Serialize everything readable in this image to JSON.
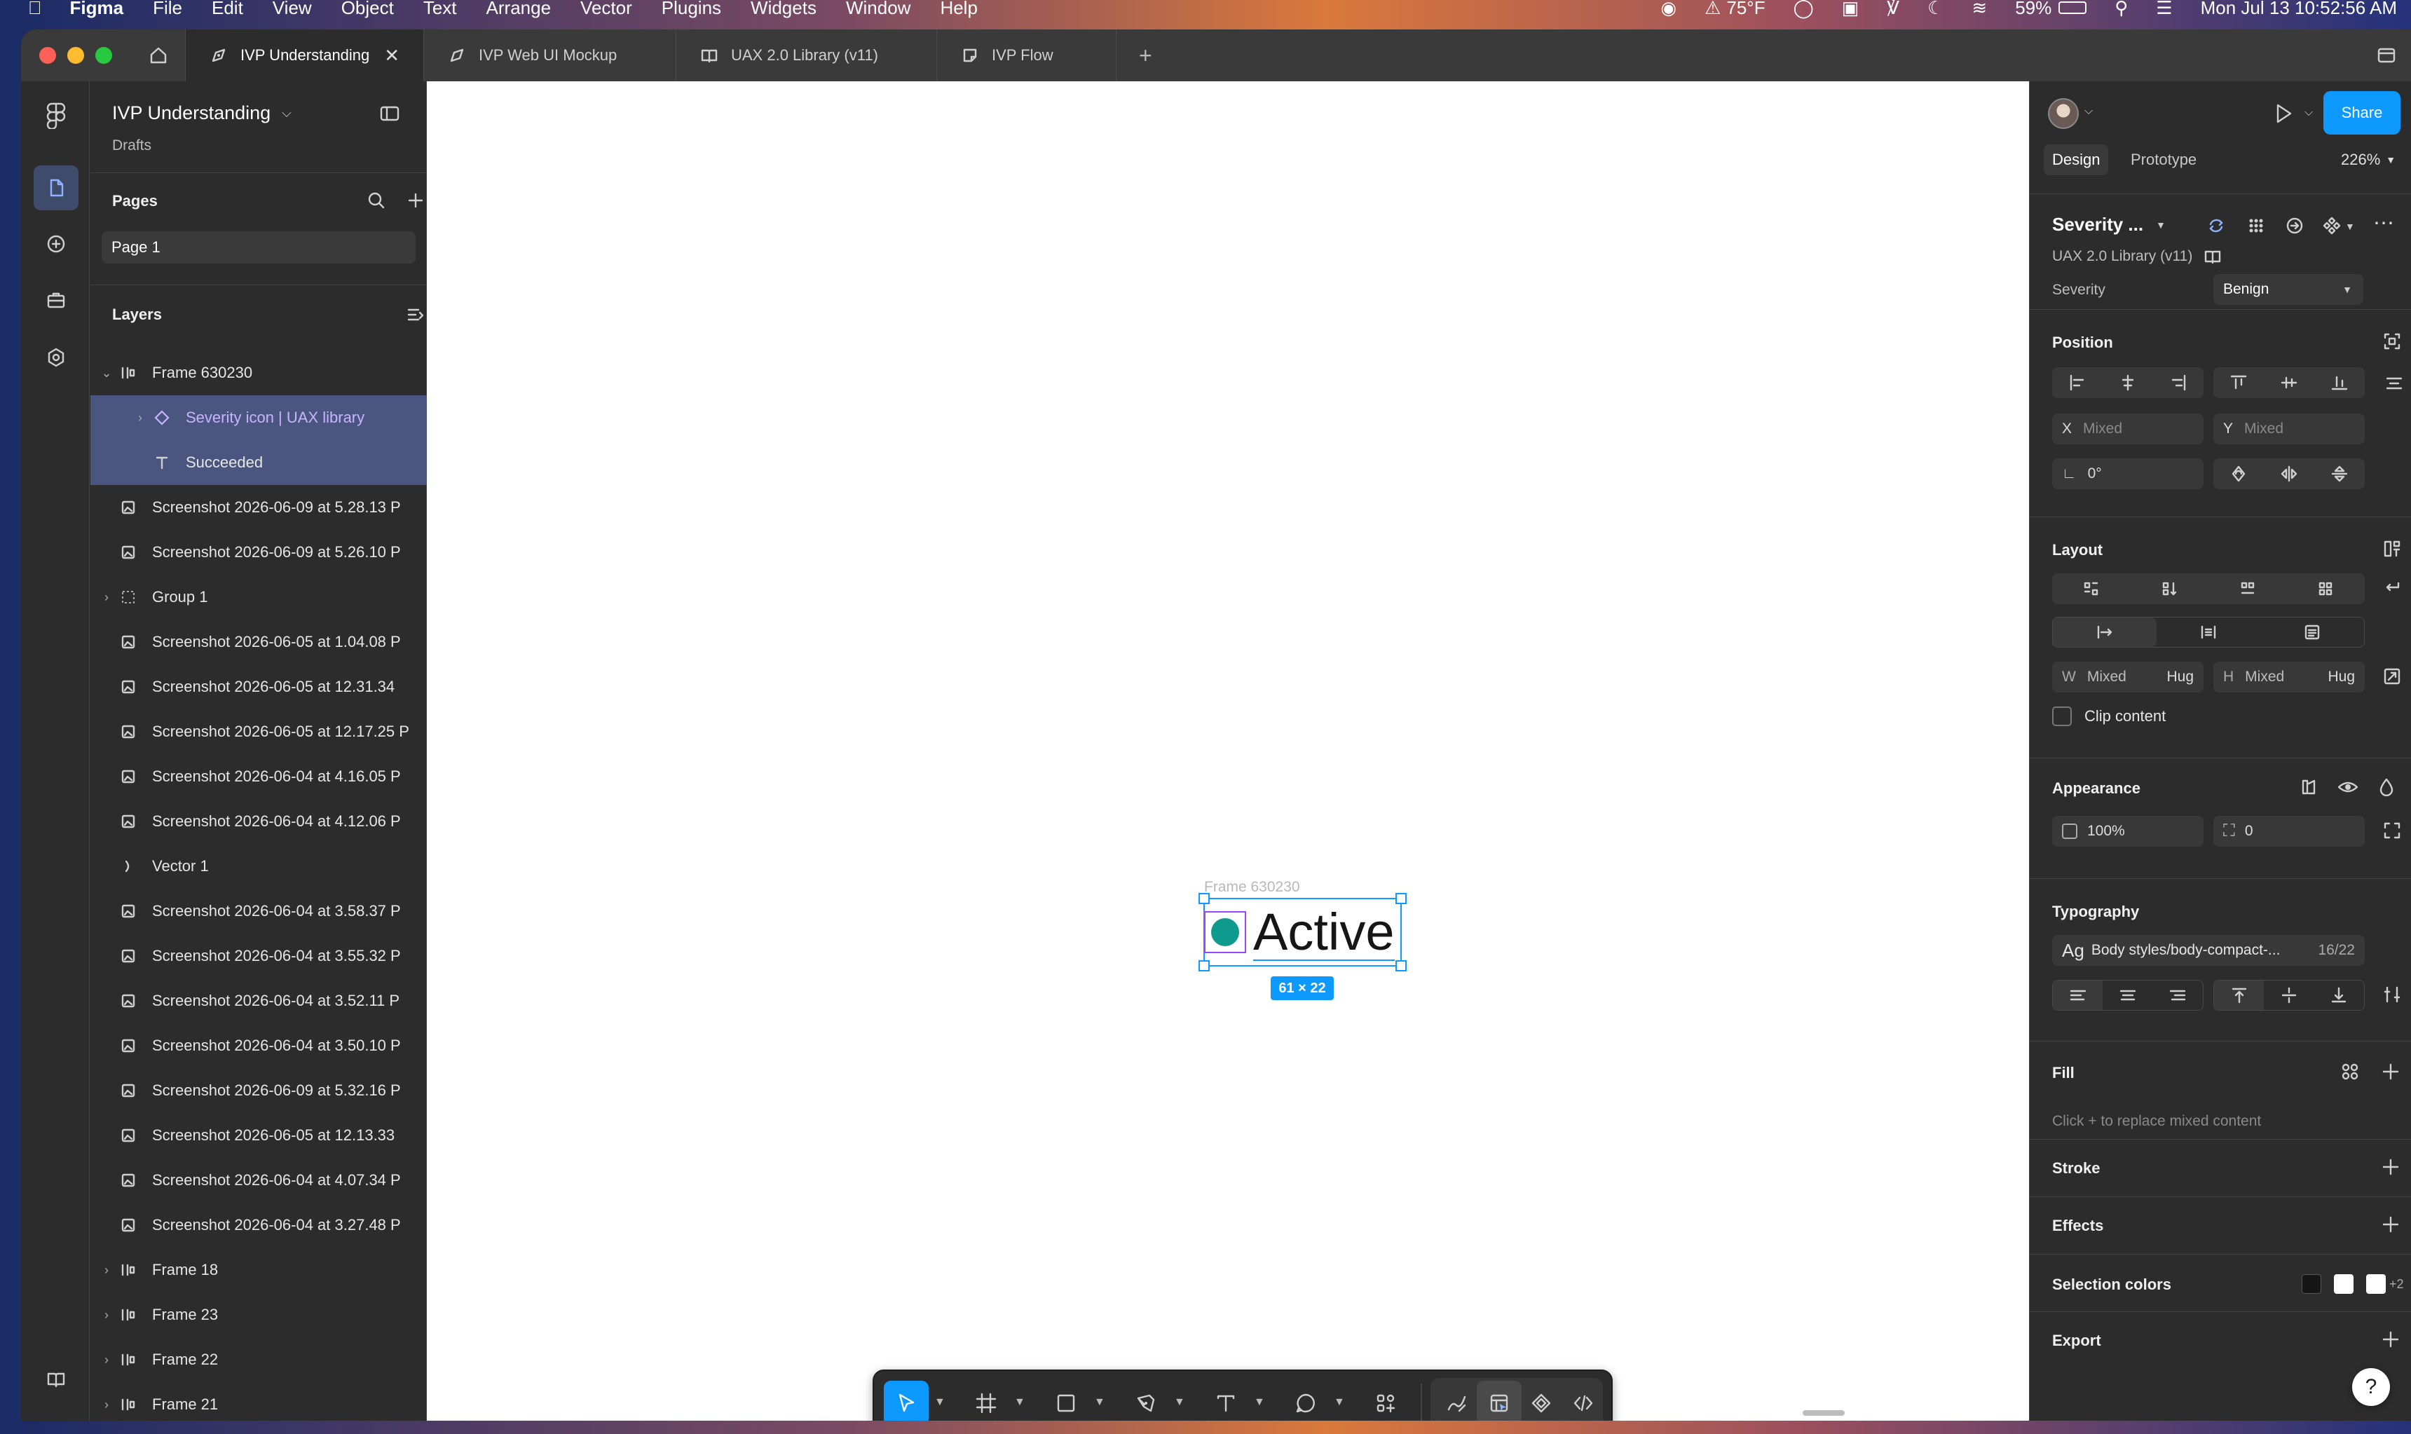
{
  "menubar": {
    "app": "Figma",
    "items": [
      "File",
      "Edit",
      "View",
      "Object",
      "Text",
      "Arrange",
      "Vector",
      "Plugins",
      "Widgets",
      "Window",
      "Help"
    ],
    "weather": "75°F",
    "battery": "59%",
    "datetime": "Mon Jul 13  10:52:56 AM"
  },
  "tabs": [
    {
      "label": "IVP Understanding",
      "icon": "design-file-icon"
    },
    {
      "label": "IVP Web UI Mockup",
      "icon": "design-file-icon"
    },
    {
      "label": "UAX 2.0 Library (v11)",
      "icon": "library-icon"
    },
    {
      "label": "IVP Flow",
      "icon": "figjam-icon"
    }
  ],
  "file": {
    "name": "IVP Understanding",
    "location": "Drafts"
  },
  "pages": {
    "title": "Pages",
    "items": [
      "Page 1"
    ]
  },
  "layers": {
    "title": "Layers",
    "items": [
      {
        "label": "Frame 630230",
        "type": "frame",
        "indent": 0,
        "expanded": true
      },
      {
        "label": "Severity icon | UAX library",
        "type": "instance",
        "indent": 1,
        "selected": true
      },
      {
        "label": "Succeeded",
        "type": "text",
        "indent": 1,
        "selected": true
      },
      {
        "label": "Screenshot 2026-06-09 at 5.28.13 P",
        "type": "image",
        "indent": 0
      },
      {
        "label": "Screenshot 2026-06-09 at 5.26.10 P",
        "type": "image",
        "indent": 0
      },
      {
        "label": "Group 1",
        "type": "group",
        "indent": 0,
        "collapsed": true
      },
      {
        "label": "Screenshot 2026-06-05 at 1.04.08 P",
        "type": "image",
        "indent": 0
      },
      {
        "label": "Screenshot 2026-06-05 at 12.31.34",
        "type": "image",
        "indent": 0
      },
      {
        "label": "Screenshot 2026-06-05 at 12.17.25 P",
        "type": "image",
        "indent": 0
      },
      {
        "label": "Screenshot 2026-06-04 at 4.16.05 P",
        "type": "image",
        "indent": 0
      },
      {
        "label": "Screenshot 2026-06-04 at 4.12.06 P",
        "type": "image",
        "indent": 0
      },
      {
        "label": "Vector 1",
        "type": "vector",
        "indent": 0
      },
      {
        "label": "Screenshot 2026-06-04 at 3.58.37 P",
        "type": "image",
        "indent": 0
      },
      {
        "label": "Screenshot 2026-06-04 at 3.55.32 P",
        "type": "image",
        "indent": 0
      },
      {
        "label": "Screenshot 2026-06-04 at 3.52.11 P",
        "type": "image",
        "indent": 0
      },
      {
        "label": "Screenshot 2026-06-04 at 3.50.10 P",
        "type": "image",
        "indent": 0
      },
      {
        "label": "Screenshot 2026-06-09 at 5.32.16 P",
        "type": "image",
        "indent": 0
      },
      {
        "label": "Screenshot 2026-06-05 at 12.13.33",
        "type": "image",
        "indent": 0
      },
      {
        "label": "Screenshot 2026-06-04 at 4.07.34 P",
        "type": "image",
        "indent": 0
      },
      {
        "label": "Screenshot 2026-06-04 at 3.27.48 P",
        "type": "image",
        "indent": 0
      },
      {
        "label": "Frame 18",
        "type": "frame",
        "indent": 0,
        "collapsed": true
      },
      {
        "label": "Frame 23",
        "type": "frame",
        "indent": 0,
        "collapsed": true
      },
      {
        "label": "Frame 22",
        "type": "frame",
        "indent": 0,
        "collapsed": true
      },
      {
        "label": "Frame 21",
        "type": "frame",
        "indent": 0,
        "collapsed": true
      }
    ]
  },
  "canvas": {
    "frame_label": "Frame 630230",
    "text": "Active",
    "size_badge": "61 × 22",
    "icon_color": "#0f9a8e"
  },
  "right_panel": {
    "share_label": "Share",
    "tabs": [
      "Design",
      "Prototype"
    ],
    "zoom": "226%",
    "component": {
      "name": "Severity ...",
      "library": "UAX 2.0 Library (v11)",
      "prop_label": "Severity",
      "prop_value": "Benign"
    },
    "position": {
      "title": "Position",
      "x_label": "X",
      "x_value": "Mixed",
      "y_label": "Y",
      "y_value": "Mixed",
      "rotation": "0°"
    },
    "layout": {
      "title": "Layout",
      "w_label": "W",
      "w_value": "Mixed",
      "w_mode": "Hug",
      "h_label": "H",
      "h_value": "Mixed",
      "h_mode": "Hug",
      "clip_label": "Clip content"
    },
    "appearance": {
      "title": "Appearance",
      "opacity": "100%",
      "radius": "0"
    },
    "typography": {
      "title": "Typography",
      "style_prefix": "Ag",
      "style_name": "Body styles/body-compact-...",
      "style_size": "16/22"
    },
    "fill": {
      "title": "Fill",
      "hint": "Click + to replace mixed content"
    },
    "stroke": {
      "title": "Stroke"
    },
    "effects": {
      "title": "Effects"
    },
    "selection_colors": {
      "title": "Selection colors",
      "extra": "+2"
    },
    "export": {
      "title": "Export"
    }
  },
  "colors": {
    "accent": "#0d99ff",
    "selection": "#4b5680",
    "panel": "#2c2c2c"
  }
}
